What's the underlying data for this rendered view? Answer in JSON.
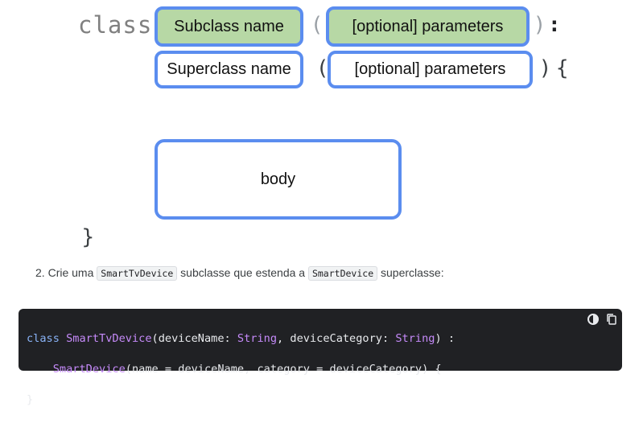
{
  "diagram": {
    "keyword_class": "class",
    "subclass_name": "Subclass name",
    "sub_params": "[optional] parameters",
    "open_paren": "(",
    "close_paren": ")",
    "colon": ":",
    "superclass_name": "Superclass name",
    "super_params": "[optional] parameters",
    "super_open_paren": "(",
    "super_close_paren": ") {",
    "body_label": "body",
    "closing_brace": "}"
  },
  "step": {
    "number": "2.",
    "text_a": "Crie uma",
    "chip_1": "SmartTvDevice",
    "text_b": "subclasse que estenda a",
    "chip_2": "SmartDevice",
    "text_c": "superclasse:"
  },
  "code": {
    "lines": [
      "class SmartTvDevice(deviceName: String, deviceCategory: String) :",
      "    SmartDevice(name = deviceName, category = deviceCategory) {",
      "}"
    ],
    "icons": [
      "theme-toggle-icon",
      "copy-icon"
    ]
  },
  "colors": {
    "box_border": "#5b8def",
    "green_fill": "#b7d8a5",
    "code_bg": "#202124"
  }
}
